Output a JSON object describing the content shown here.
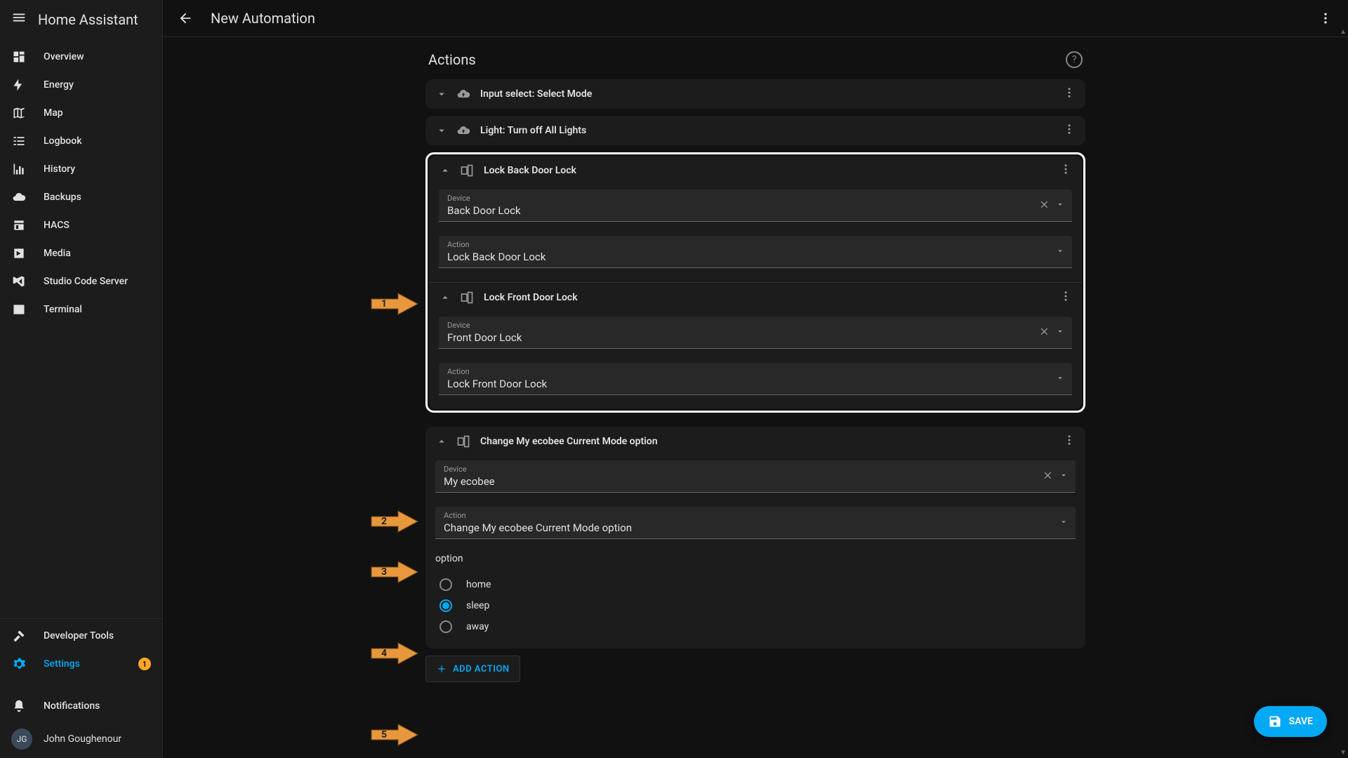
{
  "app_name": "Home Assistant",
  "page_title": "New Automation",
  "sidebar": {
    "items": [
      {
        "label": "Overview"
      },
      {
        "label": "Energy"
      },
      {
        "label": "Map"
      },
      {
        "label": "Logbook"
      },
      {
        "label": "History"
      },
      {
        "label": "Backups"
      },
      {
        "label": "HACS"
      },
      {
        "label": "Media"
      },
      {
        "label": "Studio Code Server"
      },
      {
        "label": "Terminal"
      }
    ],
    "dev_tools": "Developer Tools",
    "settings": "Settings",
    "settings_badge": "1",
    "notifications": "Notifications",
    "user_initials": "JG",
    "user_name": "John Goughenour"
  },
  "section_title": "Actions",
  "actions": {
    "a0": {
      "title": "Input select: Select Mode"
    },
    "a1": {
      "title": "Light: Turn off All Lights"
    },
    "a2": {
      "title": "Lock Back Door Lock",
      "device_label": "Device",
      "device_value": "Back Door Lock",
      "action_label": "Action",
      "action_value": "Lock Back Door Lock"
    },
    "a3": {
      "title": "Lock Front Door Lock",
      "device_label": "Device",
      "device_value": "Front Door Lock",
      "action_label": "Action",
      "action_value": "Lock Front Door Lock"
    },
    "a4": {
      "title": "Change My ecobee Current Mode option",
      "device_label": "Device",
      "device_value": "My ecobee",
      "action_label": "Action",
      "action_value": "Change My ecobee Current Mode option",
      "option_label": "option",
      "options": {
        "o0": "home",
        "o1": "sleep",
        "o2": "away"
      }
    }
  },
  "add_action_label": "ADD ACTION",
  "save_label": "SAVE",
  "arrows": {
    "n1": "1",
    "n2": "2",
    "n3": "3",
    "n4": "4",
    "n5": "5"
  }
}
